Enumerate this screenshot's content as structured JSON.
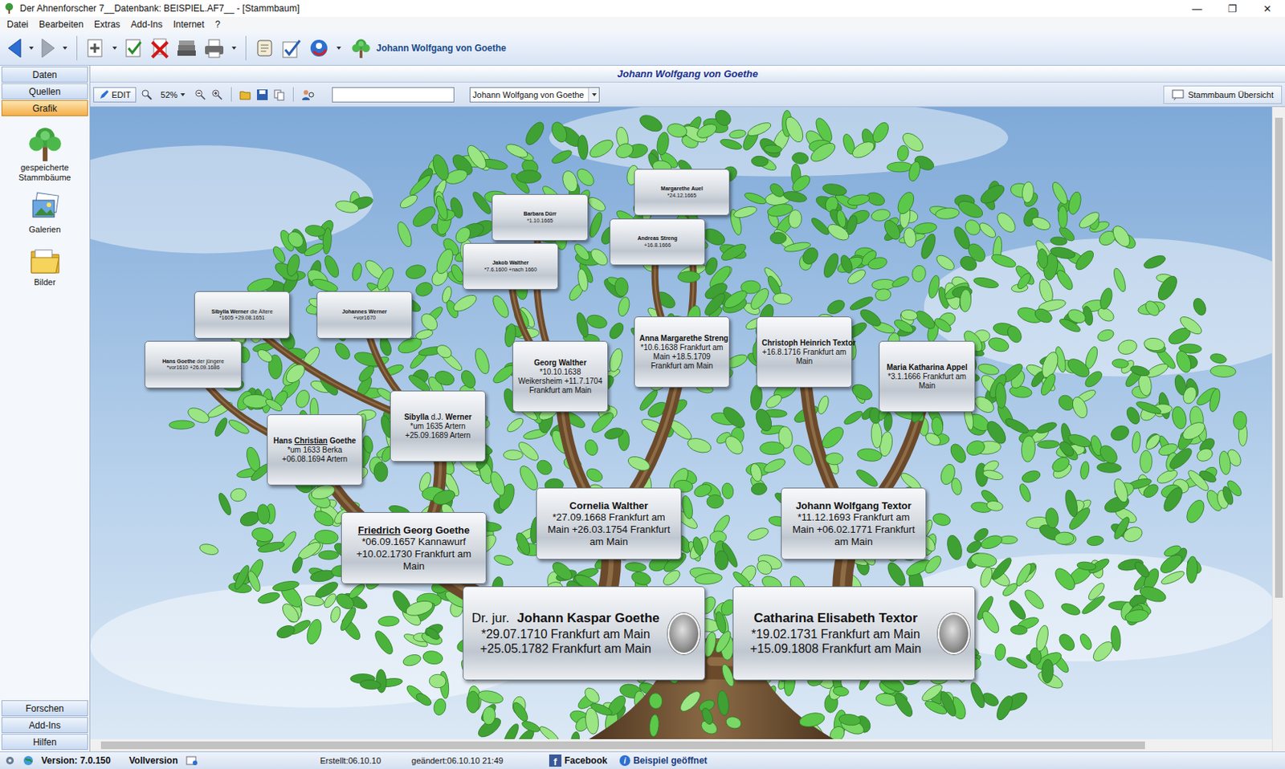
{
  "window": {
    "title": "Der Ahnenforscher 7__Datenbank: BEISPIEL.AF7__ - [Stammbaum]",
    "controls": [
      "—",
      "❐",
      "✕"
    ]
  },
  "menu": [
    {
      "label": "Datei"
    },
    {
      "label": "Bearbeiten"
    },
    {
      "label": "Extras"
    },
    {
      "label": "Add-Ins"
    },
    {
      "label": "Internet"
    },
    {
      "label": "?"
    }
  ],
  "toolbar": {
    "current_person": "Johann Wolfgang von Goethe",
    "back_enabled": true,
    "forward_enabled": false
  },
  "sidebar": {
    "sections": [
      {
        "label": "Daten",
        "selected": false
      },
      {
        "label": "Quellen",
        "selected": false
      },
      {
        "label": "Grafik",
        "selected": true
      }
    ],
    "items": [
      {
        "label": "gespeicherte Stammbäume"
      },
      {
        "label": "Galerien"
      },
      {
        "label": "Bilder"
      }
    ],
    "bottom": [
      {
        "label": "Forschen"
      },
      {
        "label": "Add-Ins"
      },
      {
        "label": "Hilfen"
      }
    ]
  },
  "view": {
    "title": "Johann Wolfgang von Goethe",
    "edit": "EDIT",
    "zoom": "52%",
    "search": "",
    "person_select": "Johann Wolfgang von Goethe",
    "overview": "Stammbaum Übersicht"
  },
  "scroll": {
    "vertical_thumb": 0.77,
    "horizontal_thumb": 0.9
  },
  "nodes": [
    {
      "name": [
        {
          "text": "Margarethe",
          "underline": false
        },
        {
          "text": "Auel",
          "underline": false
        }
      ],
      "details": "*24.12.1665",
      "portrait": false
    },
    {
      "name": [
        {
          "text": "Barbara",
          "underline": false
        },
        {
          "text": "Dürr",
          "underline": false
        }
      ],
      "details": "*1.10.1665",
      "portrait": false
    },
    {
      "name": [
        {
          "text": "Andreas",
          "underline": false
        },
        {
          "text": "Streng",
          "underline": false
        }
      ],
      "details": "+16.8.1666",
      "portrait": false
    },
    {
      "name": [
        {
          "text": "Jakob",
          "underline": false
        },
        {
          "text": "Walther",
          "underline": false
        }
      ],
      "details": "*7.6.1600 +nach 1660",
      "portrait": false
    },
    {
      "name": [
        {
          "text": "Sibylla",
          "underline": false
        },
        {
          "text": "Werner",
          "underline": false
        }
      ],
      "suffix": "die Ältere",
      "details": "*1605 +29.08.1651",
      "portrait": false
    },
    {
      "name": [
        {
          "text": "Johannes",
          "underline": false
        },
        {
          "text": "Werner",
          "underline": false
        }
      ],
      "details": "+vor1670",
      "portrait": false
    },
    {
      "name": [
        {
          "text": "Hans",
          "underline": false
        },
        {
          "text": "Goethe",
          "underline": false
        }
      ],
      "suffix": "der jüngere",
      "details": "*vor1610 +26.09.1686",
      "portrait": false
    },
    {
      "name": [
        {
          "text": "Georg",
          "underline": false
        },
        {
          "text": "Walther",
          "underline": false
        }
      ],
      "details": "*10.10.1638 Weikersheim +11.7.1704 Frankfurt am Main",
      "portrait": false
    },
    {
      "name": [
        {
          "text": "Anna",
          "underline": false
        },
        {
          "text": "Margarethe",
          "underline": false
        },
        {
          "text": "Streng",
          "underline": false
        }
      ],
      "details": "*10.6.1638 Frankfurt am Main +18.5.1709 Frankfurt am Main",
      "portrait": false
    },
    {
      "name": [
        {
          "text": "Christoph",
          "underline": false
        },
        {
          "text": "Heinrich",
          "underline": false
        },
        {
          "text": "Textor",
          "underline": false
        }
      ],
      "details": "+16.8.1716 Frankfurt am Main",
      "portrait": false
    },
    {
      "name": [
        {
          "text": "Maria",
          "underline": false
        },
        {
          "text": "Katharina",
          "underline": false
        },
        {
          "text": "Appel",
          "underline": false
        }
      ],
      "details": "*3.1.1666 Frankfurt am Main",
      "portrait": false
    },
    {
      "name": [
        {
          "text": "Hans",
          "underline": false
        },
        {
          "text": "Christian",
          "underline": true
        },
        {
          "text": "Goethe",
          "underline": false
        }
      ],
      "details": "*um 1633 Berka +06.08.1694 Artern",
      "portrait": false
    },
    {
      "name": [
        {
          "text": "Sibylla",
          "underline": false
        },
        {
          "text": "Werner",
          "underline": false
        }
      ],
      "infix": "d.J.",
      "details": "*um 1635 Artern +25.09.1689 Artern",
      "portrait": false
    },
    {
      "name": [
        {
          "text": "Friedrich",
          "underline": true
        },
        {
          "text": "Georg",
          "underline": false
        },
        {
          "text": "Goethe",
          "underline": false
        }
      ],
      "details": "*06.09.1657 Kannawurf +10.02.1730 Frankfurt am Main",
      "portrait": false
    },
    {
      "name": [
        {
          "text": "Cornelia",
          "underline": false
        },
        {
          "text": "Walther",
          "underline": false
        }
      ],
      "details": "*27.09.1668 Frankfurt am Main +26.03.1754 Frankfurt am Main",
      "portrait": false
    },
    {
      "name": [
        {
          "text": "Johann",
          "underline": false
        },
        {
          "text": "Wolfgang",
          "underline": false
        },
        {
          "text": "Textor",
          "underline": false
        }
      ],
      "details": "*11.12.1693 Frankfurt am Main +06.02.1771 Frankfurt am Main",
      "portrait": false
    },
    {
      "title": "Dr. jur.",
      "name": [
        {
          "text": "Johann",
          "underline": false
        },
        {
          "text": "Kaspar",
          "underline": false
        },
        {
          "text": "Goethe",
          "underline": false
        }
      ],
      "details": "*29.07.1710 Frankfurt am Main +25.05.1782 Frankfurt am Main",
      "portrait": true
    },
    {
      "name": [
        {
          "text": "Catharina",
          "underline": false
        },
        {
          "text": "Elisabeth",
          "underline": false
        },
        {
          "text": "Textor",
          "underline": false
        }
      ],
      "details": "*19.02.1731 Frankfurt am Main +15.09.1808 Frankfurt am Main",
      "portrait": true
    }
  ],
  "status_bar": {
    "version": "Version: 7.0.150",
    "license": "Vollversion",
    "created": "Erstellt:06.10.10",
    "changed": "geändert:06.10.10 21:49",
    "facebook_icon": "f",
    "facebook": "Facebook",
    "info_icon": "i",
    "state": "Beispiel geöffnet"
  }
}
